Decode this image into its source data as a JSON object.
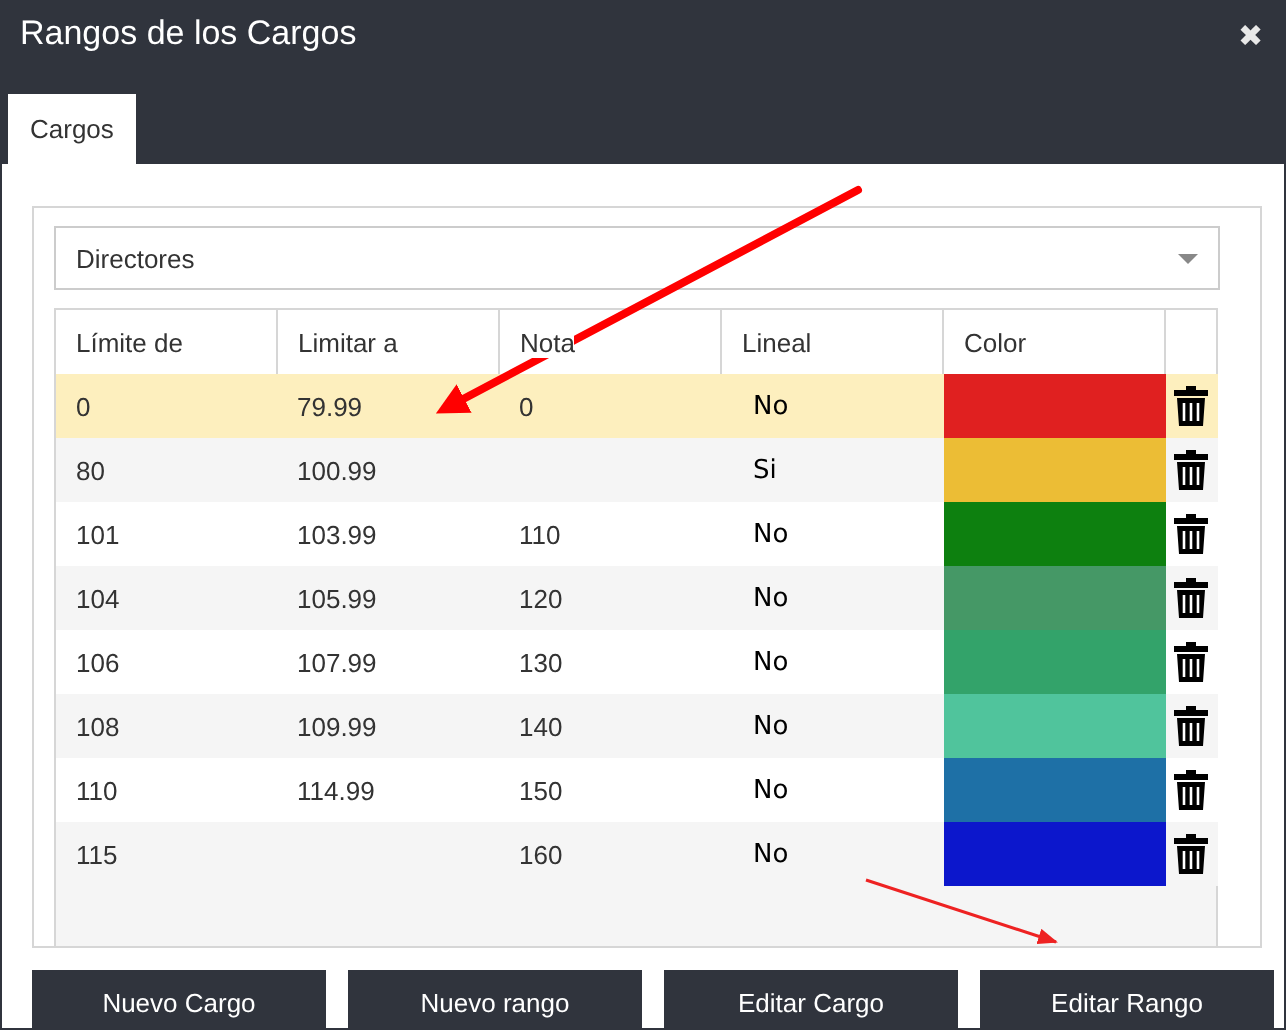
{
  "window": {
    "title": "Rangos de los Cargos",
    "close": "✖"
  },
  "tabs": [
    {
      "label": "Cargos",
      "selected": true
    }
  ],
  "dropdown": {
    "value": "Directores"
  },
  "table": {
    "columns": [
      "Límite de",
      "Limitar a",
      "Nota",
      "Lineal",
      "Color"
    ],
    "rows": [
      {
        "limite_de": "0",
        "limitar_a": "79.99",
        "nota": "0",
        "lineal": "No",
        "color": "#e02020",
        "selected": true
      },
      {
        "limite_de": "80",
        "limitar_a": "100.99",
        "lineal": "Si",
        "color": "#ecbd35",
        "selected": false
      },
      {
        "limite_de": "101",
        "limitar_a": "103.99",
        "nota": "110",
        "lineal": "No",
        "color": "#0d800f",
        "selected": false
      },
      {
        "limite_de": "104",
        "limitar_a": "105.99",
        "nota": "120",
        "lineal": "No",
        "color": "#459866",
        "selected": false
      },
      {
        "limite_de": "106",
        "limitar_a": "107.99",
        "nota": "130",
        "lineal": "No",
        "color": "#33a36a",
        "selected": false
      },
      {
        "limite_de": "108",
        "limitar_a": "109.99",
        "nota": "140",
        "lineal": "No",
        "color": "#50c49c",
        "selected": false
      },
      {
        "limite_de": "110",
        "limitar_a": "114.99",
        "nota": "150",
        "lineal": "No",
        "color": "#1e70a6",
        "selected": false
      },
      {
        "limite_de": "115",
        "nota": "160",
        "lineal": "No",
        "color": "#0c17cc",
        "selected": false
      }
    ]
  },
  "buttons": [
    "Nuevo Cargo",
    "Nuevo rango",
    "Editar Cargo",
    "Editar Rango"
  ]
}
